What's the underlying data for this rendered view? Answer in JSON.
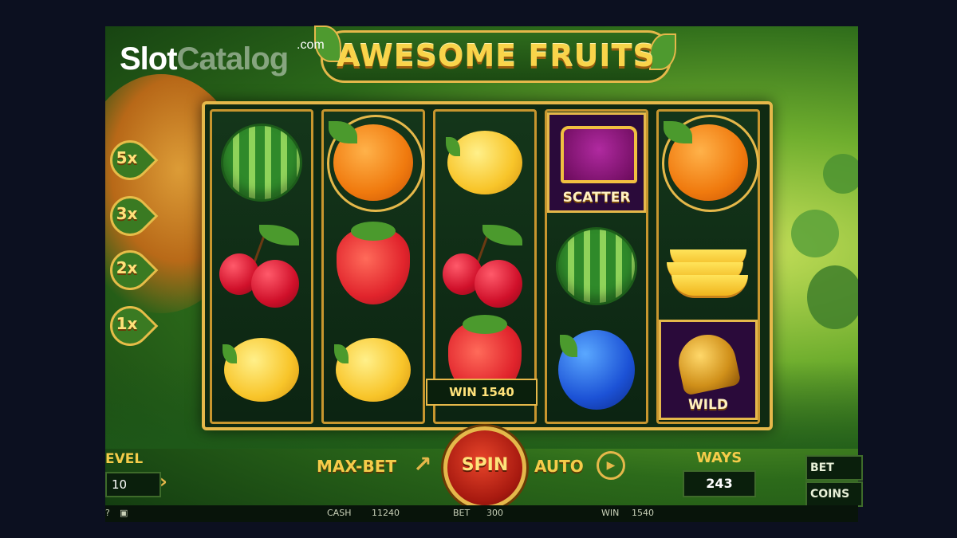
{
  "watermark": {
    "brand_a": "Slot",
    "brand_b": "Catalog",
    "domain": ".com"
  },
  "game": {
    "title": "AWESOME FRUITS"
  },
  "multipliers": [
    "5x",
    "3x",
    "2x",
    "1x"
  ],
  "reels": [
    [
      {
        "symbol": "watermelon"
      },
      {
        "symbol": "cherries"
      },
      {
        "symbol": "lemon"
      }
    ],
    [
      {
        "symbol": "orange"
      },
      {
        "symbol": "strawberry"
      },
      {
        "symbol": "lemon"
      }
    ],
    [
      {
        "symbol": "lemon"
      },
      {
        "symbol": "cherries"
      },
      {
        "symbol": "strawberry"
      }
    ],
    [
      {
        "symbol": "crown-scatter",
        "label": "SCATTER"
      },
      {
        "symbol": "watermelon"
      },
      {
        "symbol": "plum"
      }
    ],
    [
      {
        "symbol": "orange"
      },
      {
        "symbol": "banana"
      },
      {
        "symbol": "bell-wild",
        "label": "WILD"
      }
    ]
  ],
  "win_banner": "WIN 1540",
  "controls": {
    "level_label": "EVEL",
    "level_value": "10",
    "max_bet_label": "MAX-BET",
    "spin_label": "SPIN",
    "auto_label": "AUTO",
    "ways_label": "WAYS",
    "ways_value": "243",
    "bet_label": "BET",
    "coins_label": "COINS"
  },
  "status": {
    "cash_label": "CASH",
    "cash_value": "11240",
    "bet_label": "BET",
    "bet_value": "300",
    "win_label": "WIN",
    "win_value": "1540"
  },
  "colors": {
    "accent_gold": "#e5b84a",
    "spin_red": "#c8291a",
    "title_yellow": "#f9d44a"
  }
}
